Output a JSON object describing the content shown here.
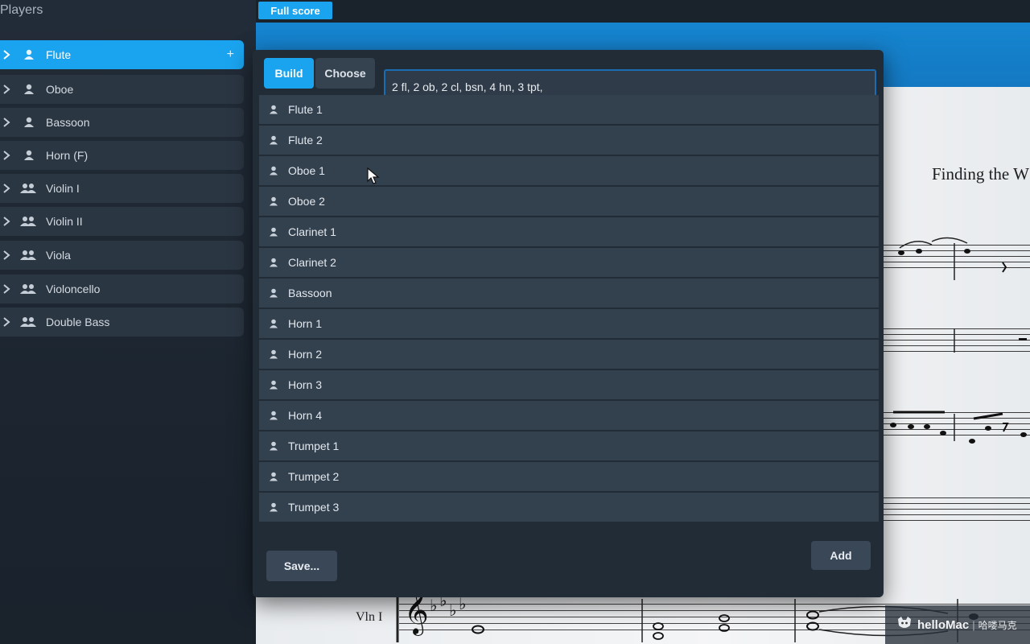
{
  "players_panel": {
    "title": "Players",
    "items": [
      {
        "label": "Flute",
        "kind": "solo",
        "selected": true
      },
      {
        "label": "Oboe",
        "kind": "solo",
        "selected": false
      },
      {
        "label": "Bassoon",
        "kind": "solo",
        "selected": false
      },
      {
        "label": "Horn (F)",
        "kind": "solo",
        "selected": false
      },
      {
        "label": "Violin I",
        "kind": "section",
        "selected": false
      },
      {
        "label": "Violin II",
        "kind": "section",
        "selected": false
      },
      {
        "label": "Viola",
        "kind": "section",
        "selected": false
      },
      {
        "label": "Violoncello",
        "kind": "section",
        "selected": false
      },
      {
        "label": "Double Bass",
        "kind": "section",
        "selected": false
      }
    ],
    "add_icon": "+"
  },
  "score": {
    "tab_label": "Full score",
    "title_fragment": "Finding the W",
    "staff_label": "Vln I"
  },
  "dialog": {
    "tabs": {
      "build": "Build",
      "choose": "Choose"
    },
    "input_value": "2 fl, 2 ob, 2 cl, bsn, 4 hn, 3 tpt,",
    "instruments": [
      "Flute 1",
      "Flute 2",
      "Oboe 1",
      "Oboe 2",
      "Clarinet 1",
      "Clarinet 2",
      "Bassoon",
      "Horn 1",
      "Horn 2",
      "Horn 3",
      "Horn 4",
      "Trumpet 1",
      "Trumpet 2",
      "Trumpet 3"
    ],
    "save_label": "Save...",
    "add_label": "Add"
  },
  "watermark": {
    "brand": "helloMac",
    "separator": "|",
    "chinese": "哈喽马克"
  },
  "colors": {
    "accent": "#1aa3ee",
    "panel_bg": "#222c37",
    "row_bg": "#33404e",
    "score_blue": "#1685d0"
  }
}
